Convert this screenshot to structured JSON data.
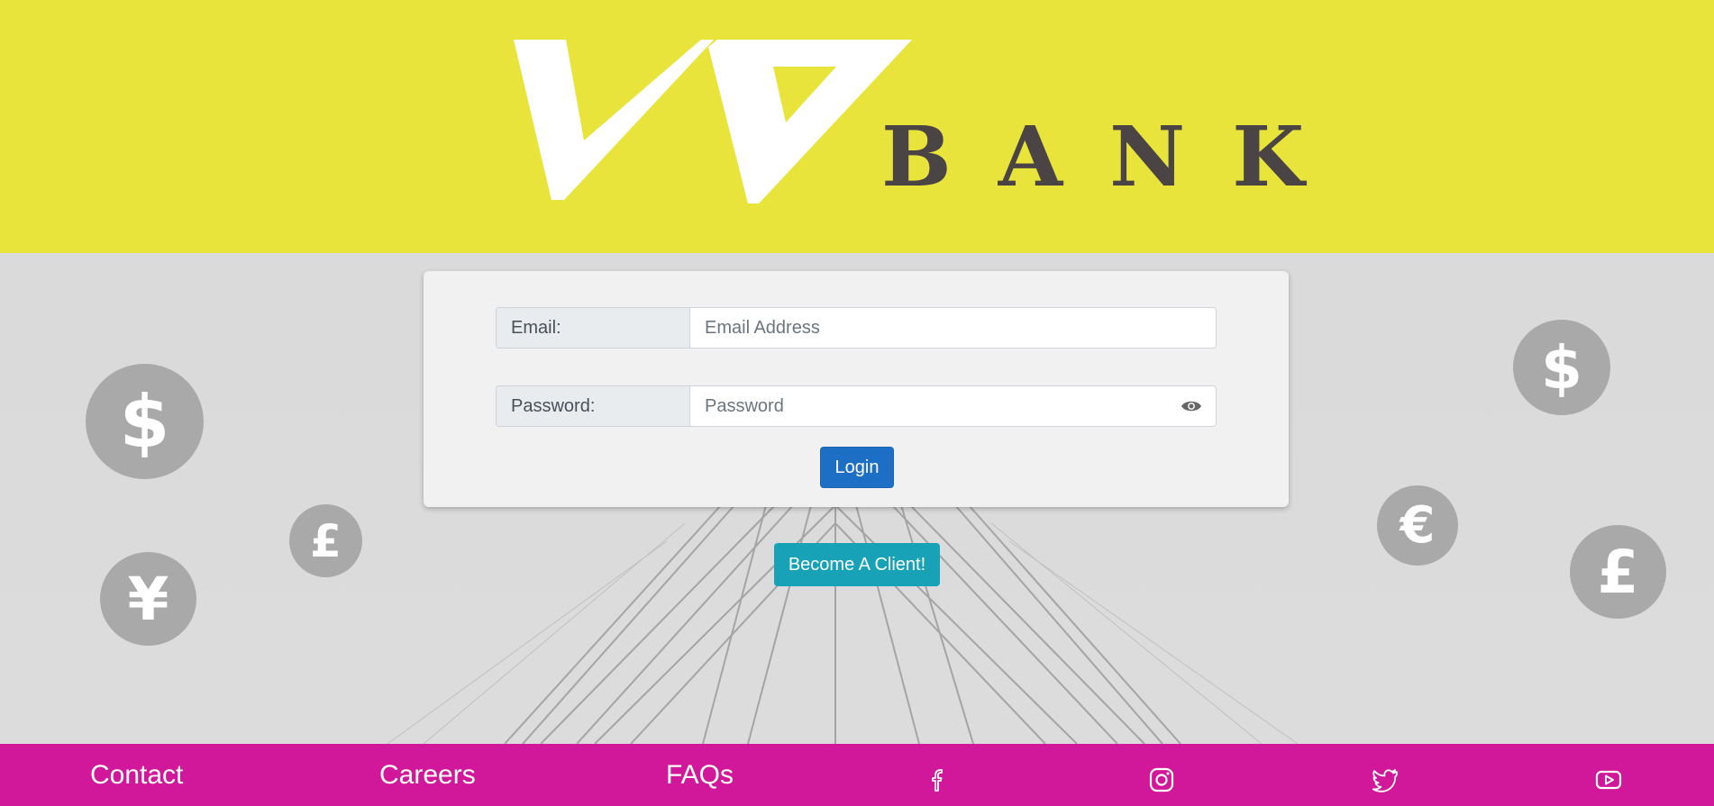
{
  "brand": {
    "logo_text": "BANK"
  },
  "login": {
    "email_label": "Email:",
    "email_placeholder": "Email Address",
    "password_label": "Password:",
    "password_placeholder": "Password",
    "login_button": "Login"
  },
  "cta": {
    "become_client": "Become A Client!"
  },
  "coins": [
    {
      "symbol": "$"
    },
    {
      "symbol": "£"
    },
    {
      "symbol": "¥"
    },
    {
      "symbol": "$"
    },
    {
      "symbol": "€"
    },
    {
      "symbol": "£"
    }
  ],
  "footer": {
    "links": [
      "Contact",
      "Careers",
      "FAQs"
    ],
    "social_icons": [
      "facebook-icon",
      "instagram-icon",
      "twitter-icon",
      "youtube-icon"
    ]
  },
  "colors": {
    "header_bg": "#e9e43c",
    "footer_bg": "#d2189a",
    "login_button": "#1c6fc4",
    "client_button": "#17a2b8",
    "logo_text": "#4a4445"
  }
}
